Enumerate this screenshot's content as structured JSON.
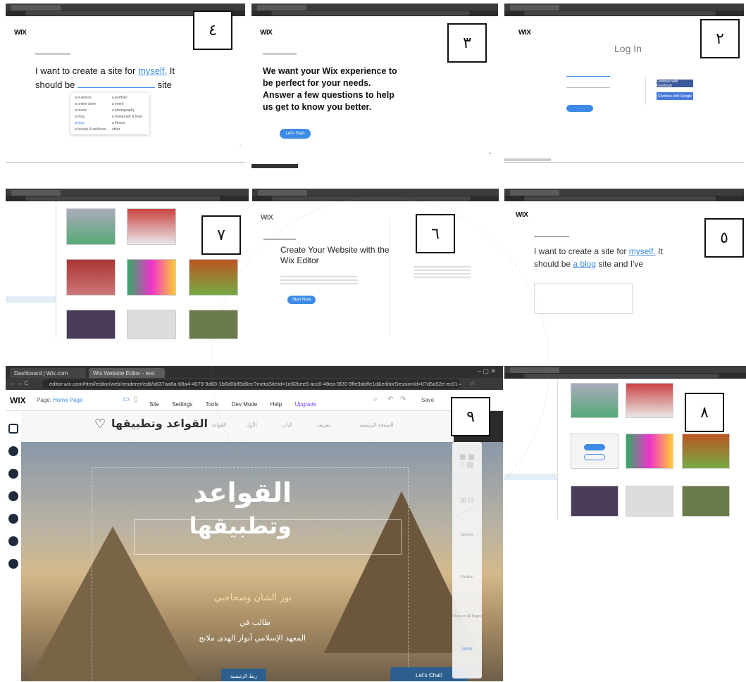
{
  "steps": {
    "s2": {
      "number": "٢",
      "title": "Log In",
      "facebook": "Continue with Facebook",
      "google": "Continue with Google"
    },
    "s3": {
      "number": "٣",
      "heading": "We want your Wix experience to be perfect for your needs. Answer a few questions to help us get to know you better.",
      "button": "Let's Start"
    },
    "s4": {
      "number": "٤",
      "q1": "I want to create a site for ",
      "q1_link": "myself.",
      "q1_tail": " It",
      "q2": "should be",
      "q2_tail": "site",
      "options": [
        "a business",
        "a portfolio",
        "a online store",
        "a event",
        "a music",
        "a photography",
        "a blog",
        "a restaurant & food",
        "a blog",
        "a fitness",
        "a beauty & wellness",
        "other"
      ]
    },
    "s5": {
      "number": "٥",
      "q1": "I want to create a site for ",
      "q1_link": "myself.",
      "q1_tail": " It",
      "q2": "should be ",
      "q2_link": "a blog",
      "q2_tail": " site and I've"
    },
    "s6": {
      "number": "٦",
      "heading": "Create Your Website with the Wix Editor",
      "button": "Start Now"
    },
    "s7": {
      "number": "٧"
    },
    "s8": {
      "number": "٨"
    },
    "s9": {
      "number": "٩",
      "tab1": "Dashboard | Wix.com",
      "tab2": "Wix Website Editor - test",
      "url": "editor.wix.com/html/editor/web/renderer/edit/a637aa8a-68a4-4079-9d83-1b6d0b85d6ec?metaSiteId=1e82bee5-acc6-48ea-9f20-9ffe9abffe1d&editorSessionId=07d5a52e-ec01-4cee-9042-fac",
      "wix_logo": "WIX",
      "page_label": "Page: ",
      "page_value": "Home Page",
      "menu": [
        "Site",
        "Settings",
        "Tools",
        "Dev Mode",
        "Help",
        "Upgrade"
      ],
      "save": "Save",
      "site_logo": "القواعد وتطبيقها",
      "nav": [
        "الصفحة الرئيسية",
        "تعريف",
        "الباب",
        "الأول",
        "القواعد"
      ],
      "hero_title1": "القواعد",
      "hero_title2": "وتطبيقها",
      "hero_sub1": "نور الشان وصحاحبي",
      "hero_sub2": "طالب في",
      "hero_sub3": "المعهد الإسلامي أنوار الهدى ملانج",
      "cta": "ربط الرئيسية",
      "chat": "Let's Chat!",
      "panel": [
        "Spacing",
        "Position",
        "Show on All Pages",
        "Layout"
      ]
    }
  },
  "wix_logo": "WIX"
}
